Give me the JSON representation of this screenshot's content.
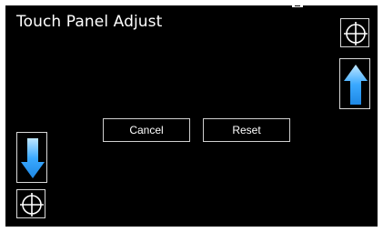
{
  "screen": {
    "title": "Touch Panel Adjust"
  },
  "buttons": {
    "cancel_label": "Cancel",
    "reset_label": "Reset"
  },
  "icons": {
    "target_top_right": "crosshair-target-icon",
    "target_bottom_left": "crosshair-target-icon",
    "arrow_up": "up-arrow-icon",
    "arrow_down": "down-arrow-icon"
  },
  "colors": {
    "background": "#000000",
    "text": "#ffffff",
    "arrow_light": "#bfe7ff",
    "arrow_mid": "#3aa9ff",
    "arrow_dark": "#1e88e5",
    "border": "#d9d9d9"
  }
}
